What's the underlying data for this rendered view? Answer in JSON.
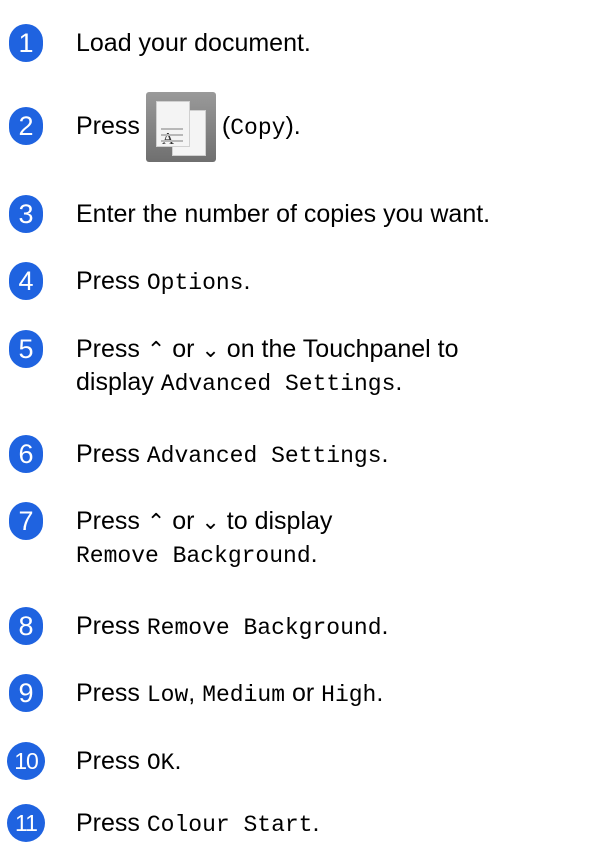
{
  "steps": [
    {
      "num": "1",
      "before": "Load your document."
    },
    {
      "num": "2",
      "before": "Press",
      "icon": "copy-icon",
      "paren_open": "(",
      "mono": "Copy",
      "paren_close": ")."
    },
    {
      "num": "3",
      "before": "Enter the number of copies you want."
    },
    {
      "num": "4",
      "before": "Press ",
      "mono": "Options",
      "after": "."
    },
    {
      "num": "5",
      "line1_before": "Press ",
      "up": "⌃",
      "or": " or ",
      "down": "⌄",
      "line1_after": " on the Touchpanel to",
      "line2_before": "display ",
      "line2_mono": "Advanced Settings",
      "line2_after": "."
    },
    {
      "num": "6",
      "before": "Press ",
      "mono": "Advanced Settings",
      "after": "."
    },
    {
      "num": "7",
      "line1_before": "Press ",
      "up": "⌃",
      "or": " or ",
      "down": "⌄",
      "line1_after": " to display",
      "line2_mono": "Remove Background",
      "line2_after": "."
    },
    {
      "num": "8",
      "before": "Press ",
      "mono": "Remove Background",
      "after": "."
    },
    {
      "num": "9",
      "before": "Press ",
      "mono1": "Low",
      "sep1": ", ",
      "mono2": "Medium",
      "sep2": " or ",
      "mono3": "High",
      "after": "."
    },
    {
      "num": "10",
      "before": "Press ",
      "mono": "OK",
      "after": "."
    },
    {
      "num": "11",
      "before": "Press ",
      "mono": "Colour Start",
      "after": "."
    }
  ]
}
